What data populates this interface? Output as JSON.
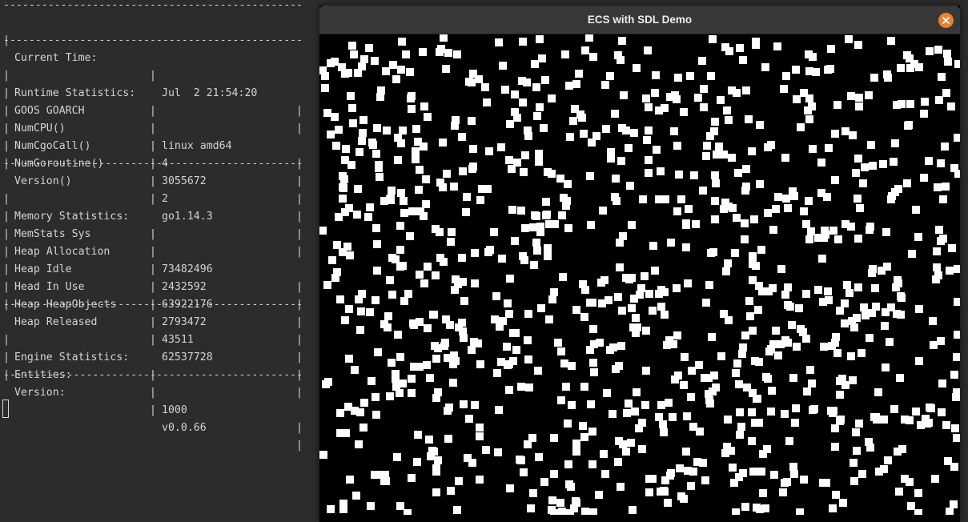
{
  "terminal": {
    "separator": "-----------------------------------------------",
    "time_row": {
      "label": "Current Time:",
      "value": "Jul  2 21:54:20"
    },
    "sections": [
      {
        "title": "Runtime Statistics:",
        "rows": [
          {
            "label": "GOOS GOARCH",
            "value": "linux amd64"
          },
          {
            "label": "NumCPU()",
            "value": "4"
          },
          {
            "label": "NumCgoCall()",
            "value": "3055672"
          },
          {
            "label": "NumGoroutine()",
            "value": "2"
          },
          {
            "label": "Version()",
            "value": "go1.14.3"
          }
        ]
      },
      {
        "title": "Memory Statistics:",
        "rows": [
          {
            "label": "MemStats Sys",
            "value": "73482496"
          },
          {
            "label": "Heap Allocation",
            "value": "2432592"
          },
          {
            "label": "Heap Idle",
            "value": "63922176"
          },
          {
            "label": "Head In Use",
            "value": "2793472"
          },
          {
            "label": "Heap HeapObjects",
            "value": "43511"
          },
          {
            "label": "Heap Released",
            "value": "62537728"
          }
        ]
      },
      {
        "title": "Engine Statistics:",
        "rows": [
          {
            "label": "Entities:",
            "value": "1000"
          },
          {
            "label": "Version:",
            "value": "v0.0.66"
          }
        ]
      }
    ]
  },
  "sdl_window": {
    "title": "ECS with SDL Demo",
    "close_icon": "close-icon",
    "close_button_color": "#e9812f",
    "entity_count": 1000,
    "entity_color": "#ffffff",
    "background_color": "#000000"
  }
}
